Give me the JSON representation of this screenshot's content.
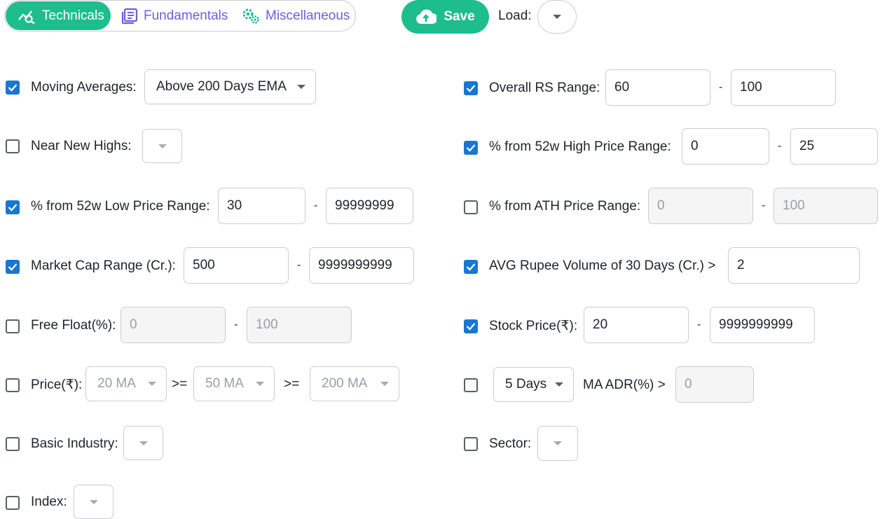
{
  "tabs": [
    {
      "label": "Technicals",
      "icon": "chart-search-icon",
      "active": true
    },
    {
      "label": "Fundamentals",
      "icon": "document-list-icon",
      "active": false
    },
    {
      "label": "Miscellaneous",
      "icon": "gears-icon",
      "active": false
    }
  ],
  "toolbar": {
    "save_label": "Save",
    "load_label": "Load:"
  },
  "left": {
    "moving_averages": {
      "label": "Moving Averages:",
      "value": "Above 200 Days EMA"
    },
    "near_new_highs": {
      "label": "Near New Highs:"
    },
    "low_range": {
      "label": "% from 52w Low Price Range:",
      "min": "30",
      "max": "99999999"
    },
    "market_cap": {
      "label": "Market Cap Range (Cr.):",
      "min": "500",
      "max": "9999999999"
    },
    "free_float": {
      "label": "Free Float(%):",
      "min": "0",
      "max": "100"
    },
    "price": {
      "label": "Price(₹):",
      "ma1": "20 MA",
      "ma2": "50 MA",
      "ma3": "200 MA",
      "gte": ">="
    },
    "basic_industry": {
      "label": "Basic Industry:"
    },
    "index": {
      "label": "Index:"
    }
  },
  "right": {
    "overall_rs": {
      "label": "Overall RS Range:",
      "min": "60",
      "max": "100"
    },
    "high_range": {
      "label": "% from 52w High Price Range:",
      "min": "0",
      "max": "25"
    },
    "ath_range": {
      "label": "% from ATH Price Range:",
      "min": "0",
      "max": "100"
    },
    "avg_volume": {
      "label": "AVG Rupee Volume of 30 Days (Cr.) >",
      "value": "2"
    },
    "stock_price": {
      "label": "Stock Price(₹):",
      "min": "20",
      "max": "9999999999"
    },
    "adr": {
      "days": "5 Days",
      "label": "MA ADR(%) >",
      "value": "0"
    },
    "sector": {
      "label": "Sector:"
    }
  },
  "dash": "-"
}
